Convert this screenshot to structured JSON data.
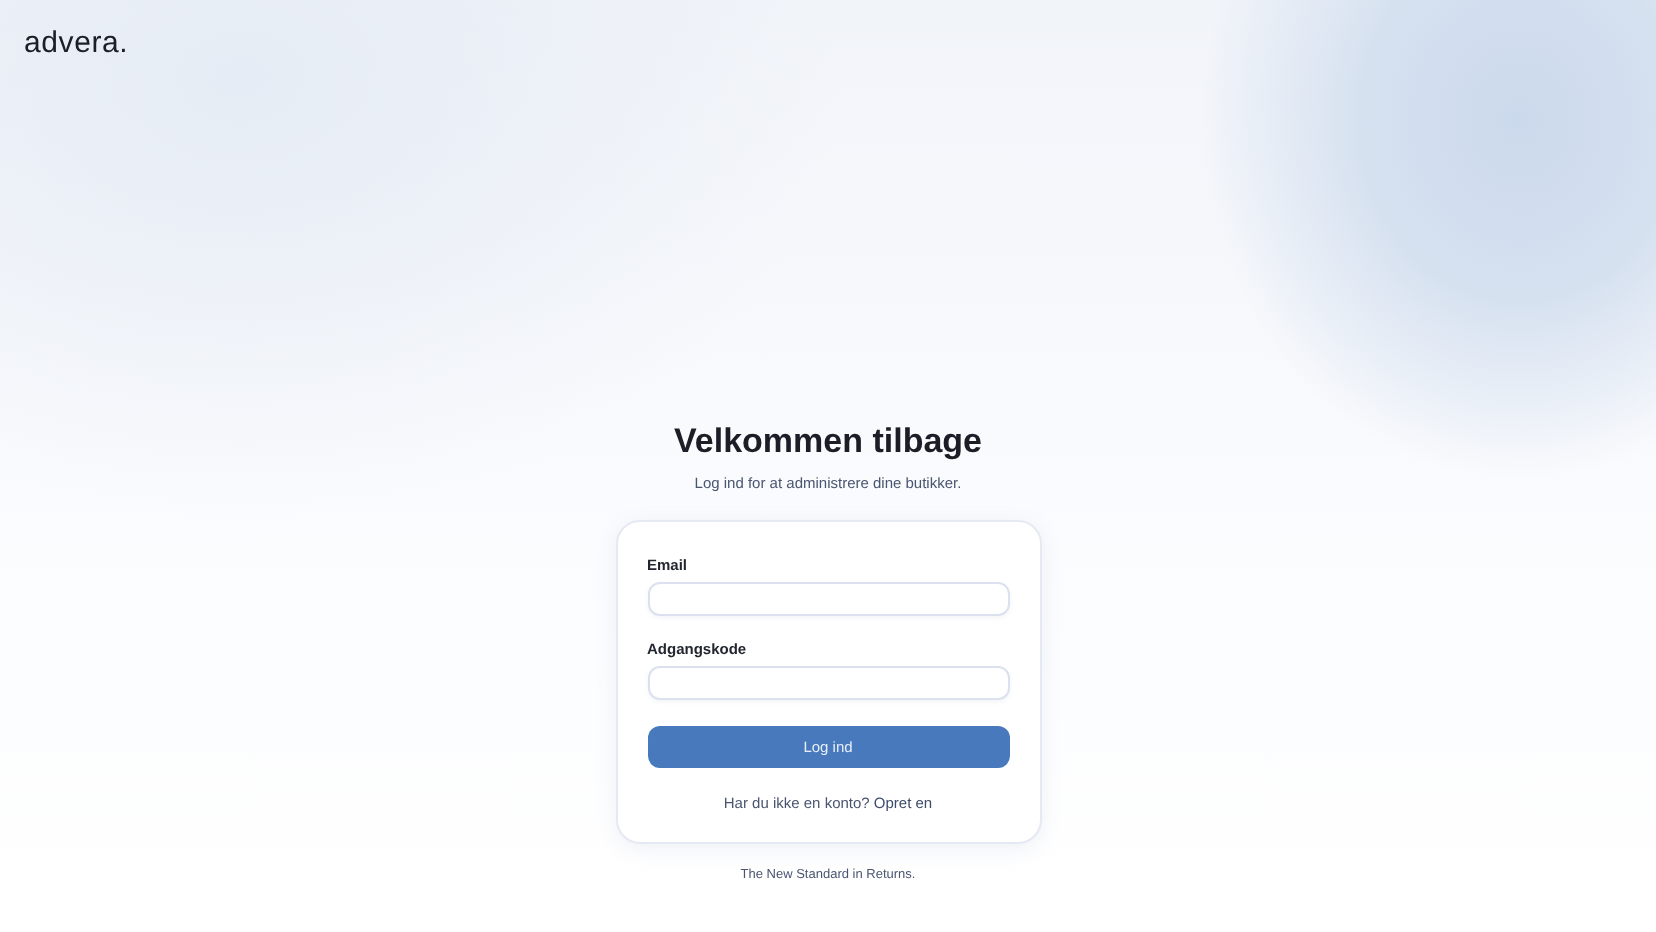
{
  "brand": {
    "logo": "advera."
  },
  "heading": {
    "title": "Velkommen tilbage",
    "subtitle": "Log ind for at administrere dine butikker."
  },
  "form": {
    "fields": [
      {
        "label": "Email"
      },
      {
        "label": "Adgangskode"
      }
    ],
    "submit": "Log ind",
    "signup": {
      "question": "Har du ikke en konto?",
      "link": "Opret en"
    }
  },
  "footer": "The New Standard in Returns."
}
